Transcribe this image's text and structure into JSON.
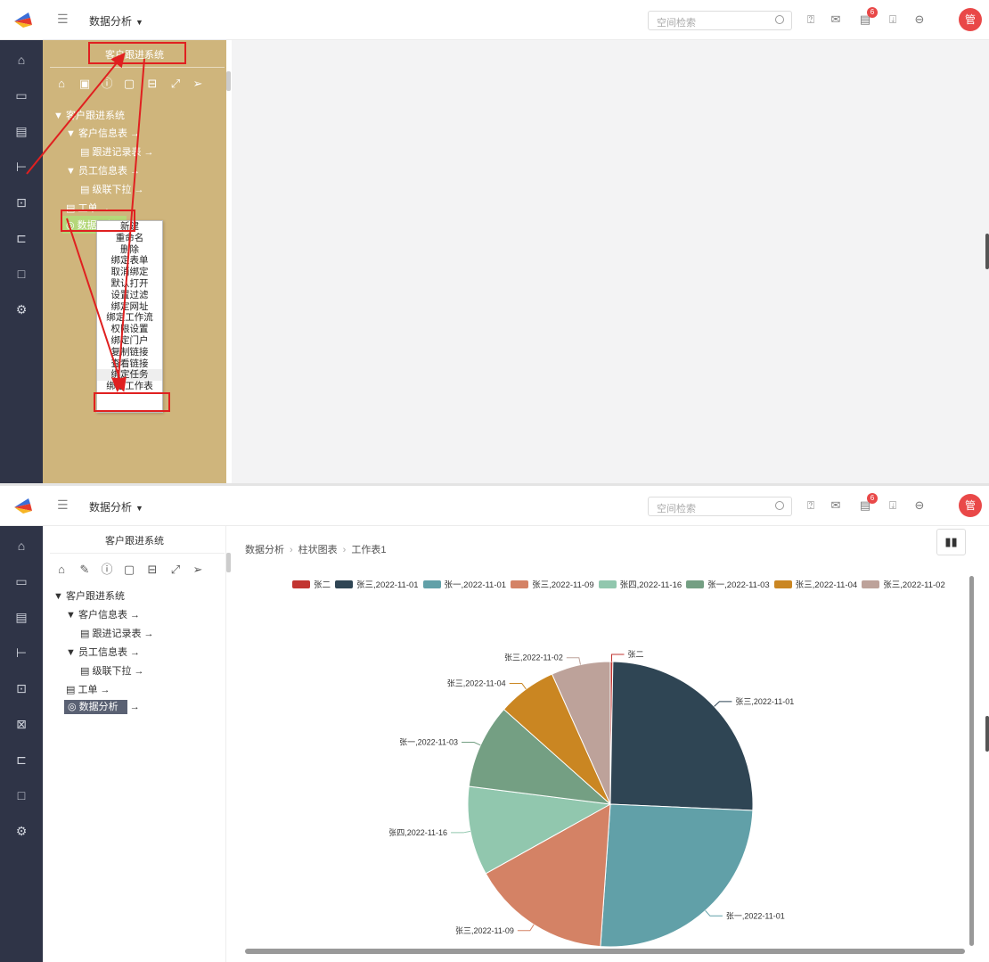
{
  "app": {
    "title": "数据分析",
    "search_placeholder": "空间检索",
    "badge_count": "6",
    "avatar": "管"
  },
  "tree": {
    "root_title": "客户跟进系统",
    "nodes": {
      "system": "客户跟进系统",
      "customer_info": "客户信息表",
      "followup_records": "跟进记录表",
      "employee_info": "员工信息表",
      "cascade": "级联下拉",
      "work_order": "工单",
      "data_analysis": "数据分析"
    },
    "arrow": "→"
  },
  "context_menu": {
    "items": [
      "新建",
      "重命名",
      "删除",
      "绑定表单",
      "取消绑定",
      "默认打开",
      "设置过滤",
      "绑定网址",
      "绑定工作流",
      "权限设置",
      "绑定门户",
      "复制链接",
      "查看链接",
      "绑定任务",
      "绑定工作表"
    ],
    "highlighted": "绑定工作表"
  },
  "breadcrumb": {
    "items": [
      "数据分析",
      "柱状图表",
      "工作表1"
    ],
    "separator": "›"
  },
  "chart_data": {
    "type": "pie",
    "title": "",
    "series": [
      {
        "name": "张二",
        "value": 0.3,
        "color": "#c23531"
      },
      {
        "name": "张三,2022-11-01",
        "value": 26.5,
        "color": "#2f4554"
      },
      {
        "name": "张一,2022-11-01",
        "value": 26.5,
        "color": "#61a0a8"
      },
      {
        "name": "张三,2022-11-09",
        "value": 16.5,
        "color": "#d48265"
      },
      {
        "name": "张四,2022-11-16",
        "value": 10.5,
        "color": "#91c7ae"
      },
      {
        "name": "张一,2022-11-03",
        "value": 10.0,
        "color": "#749f83"
      },
      {
        "name": "张三,2022-11-04",
        "value": 7.0,
        "color": "#ca8622"
      },
      {
        "name": "张三,2022-11-02",
        "value": 7.0,
        "color": "#bda29a"
      }
    ],
    "legend_position": "top"
  },
  "colors": {
    "nav_bg": "#2f3447",
    "tree_bg_highlight": "#cfb57c",
    "accent_red": "#e94848"
  }
}
